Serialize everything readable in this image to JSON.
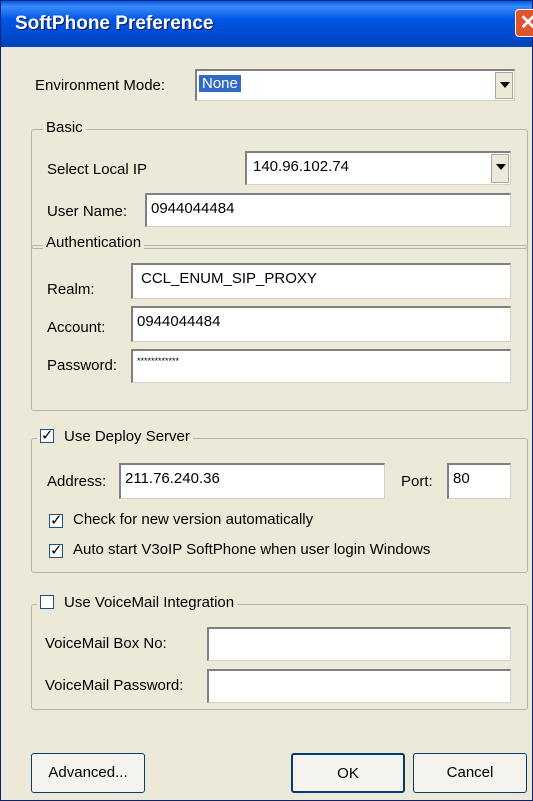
{
  "window": {
    "title": "SoftPhone Preference",
    "close_glyph": "✕"
  },
  "environment": {
    "label": "Environment Mode:",
    "value": "None"
  },
  "basic": {
    "legend": "Basic",
    "local_ip_label": "Select Local IP",
    "local_ip_value": "140.96.102.74",
    "username_label": "User Name:",
    "username_value": "0944044484"
  },
  "auth": {
    "legend": "Authentication",
    "realm_label": "Realm:",
    "realm_value": "CCL_ENUM_SIP_PROXY",
    "account_label": "Account:",
    "account_value": "0944044484",
    "password_label": "Password:",
    "password_value": "************"
  },
  "deploy": {
    "checkbox_label": "Use Deploy Server",
    "checked": true,
    "address_label": "Address:",
    "address_value": "211.76.240.36",
    "port_label": "Port:",
    "port_value": "80",
    "check_version_label": "Check for new version automatically",
    "check_version_checked": true,
    "autostart_label": "Auto start V3oIP SoftPhone when user login Windows",
    "autostart_checked": true
  },
  "voicemail": {
    "checkbox_label": "Use VoiceMail Integration",
    "checked": false,
    "box_label": "VoiceMail Box No:",
    "box_value": "",
    "password_label": "VoiceMail Password:",
    "password_value": ""
  },
  "buttons": {
    "advanced": "Advanced...",
    "ok": "OK",
    "cancel": "Cancel"
  }
}
